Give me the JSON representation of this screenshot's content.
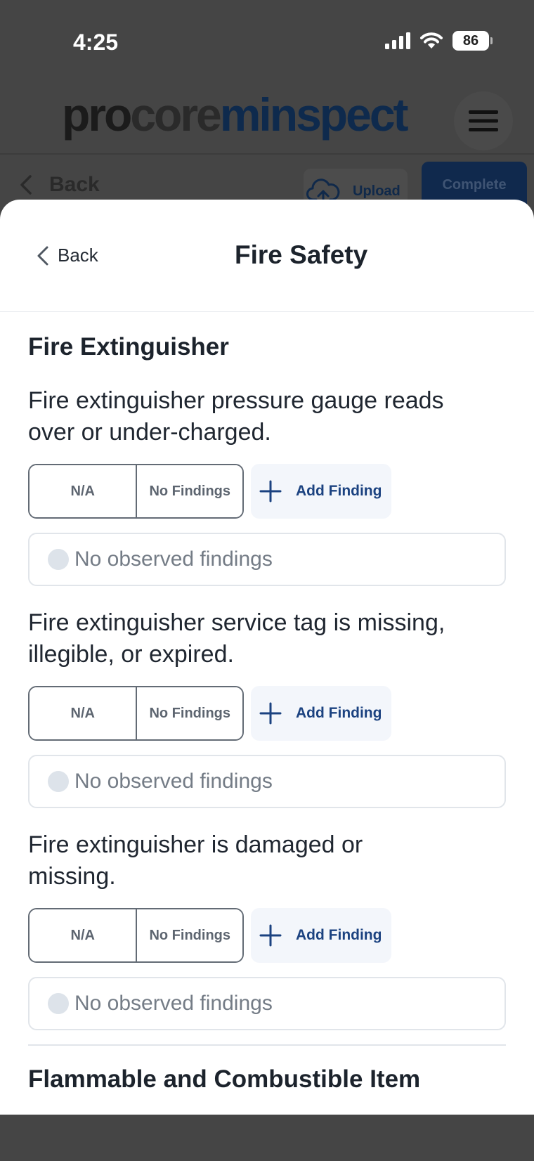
{
  "status_bar": {
    "time": "4:25",
    "battery": "86",
    "icons": [
      "signal-icon",
      "wifi-icon",
      "battery-icon"
    ]
  },
  "app_header": {
    "logo_parts": [
      "pro",
      "core",
      "minspect"
    ],
    "menu_icon": "hamburger-menu-icon"
  },
  "sub_bar": {
    "back_label": "Back",
    "upload_label": "Upload",
    "complete_label": "Complete"
  },
  "sheet": {
    "back_label": "Back",
    "title": "Fire Safety",
    "sections": [
      {
        "heading": "Fire Extinguisher",
        "items": [
          {
            "question": "Fire extinguisher pressure gauge reads over or under-charged.",
            "na_label": "N/A",
            "no_findings_label": "No Findings",
            "add_finding_label": "Add Finding",
            "finding_status": "No observed findings"
          },
          {
            "question": "Fire extinguisher service tag is missing, illegible, or expired.",
            "na_label": "N/A",
            "no_findings_label": "No Findings",
            "add_finding_label": "Add Finding",
            "finding_status": "No observed findings"
          },
          {
            "question": "Fire extinguisher is damaged or missing.",
            "na_label": "N/A",
            "no_findings_label": "No Findings",
            "add_finding_label": "Add Finding",
            "finding_status": "No observed findings"
          }
        ]
      },
      {
        "heading": "Flammable and Combustible Item"
      }
    ]
  },
  "colors": {
    "overlay_background": "#454545",
    "accent_blue": "#1b4280",
    "sheet_background": "#ffffff",
    "add_button_background": "#f3f6fb"
  }
}
